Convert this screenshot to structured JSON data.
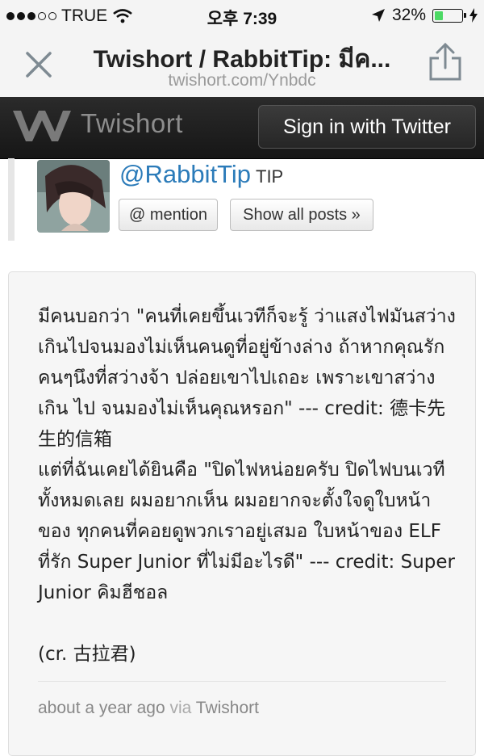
{
  "status_bar": {
    "carrier": "TRUE",
    "time": "오후 7:39",
    "battery": "32%",
    "battery_level": 0.32
  },
  "browser": {
    "title": "Twishort / RabbitTip: มีค...",
    "url": "twishort.com/Ynbdc",
    "close_icon": "close-icon",
    "share_icon": "share-icon"
  },
  "site_header": {
    "logo_text": "Twishort",
    "signin_label": "Sign in with Twitter"
  },
  "profile": {
    "handle": "@RabbitTip",
    "tag": "TIP",
    "mention_label": "@ mention",
    "show_posts_label": "Show all posts »"
  },
  "post": {
    "body": "มีคนบอกว่า \"คนที่เคยขึ้นเวทีก็จะรู้ ว่าแสงไฟมันสว่าง เกินไปจนมองไม่เห็นคนดูที่อยู่ข้างล่าง ถ้าหากคุณรัก คนๆนึงที่สว่างจ้า ปล่อยเขาไปเถอะ เพราะเขาสว่างเกิน ไป จนมองไม่เห็นคุณหรอก\" --- credit: 德卡先生的信箱\nแต่ที่ฉันเคยได้ยินคือ \"ปิดไฟหน่อยครับ ปิดไฟบนเวที ทั้งหมดเลย ผมอยากเห็น ผมอยากจะตั้งใจดูใบหน้าของ ทุกคนที่คอยดูพวกเราอยู่เสมอ ใบหน้าของ ELF ที่รัก Super Junior ที่ไม่มีอะไรดี\" --- credit: Super Junior คิมฮีชอล\n\n(cr. 古拉君)",
    "time_ago": "about a year ago",
    "via": "via",
    "app": "Twishort"
  }
}
